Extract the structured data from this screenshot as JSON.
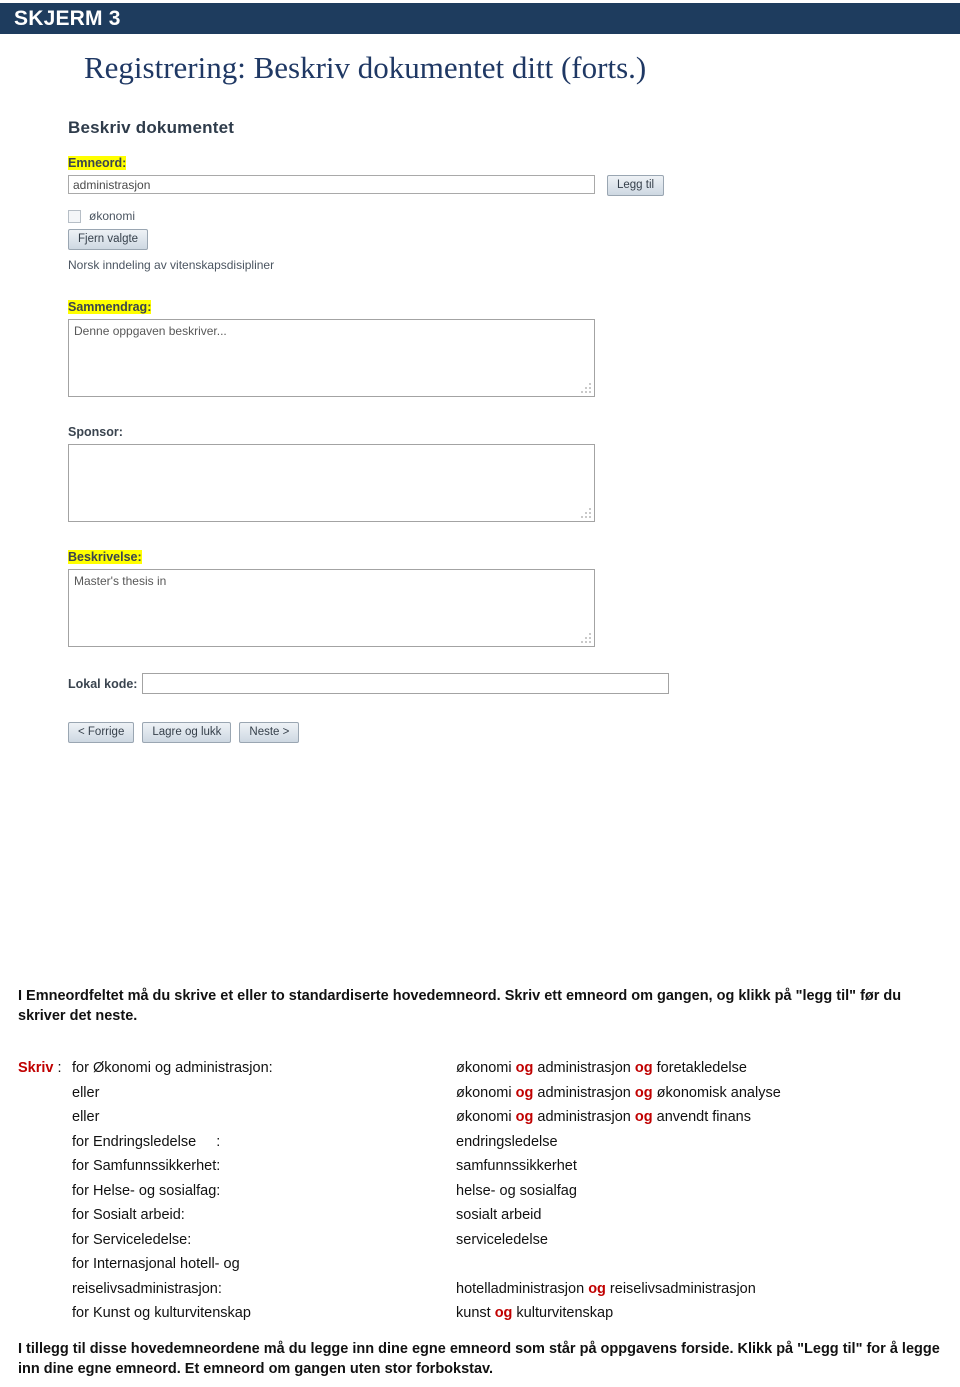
{
  "banner": {
    "label": "SKJERM 3",
    "color": "#1e3c5e"
  },
  "page_title": "Registrering: Beskriv dokumentet ditt (forts.)",
  "screenshot": {
    "heading": "Beskriv dokumentet",
    "emneord": {
      "label": "Emneord:",
      "input_value": "administrasjon",
      "add_button": "Legg til",
      "checkbox_label": "økonomi",
      "remove_button": "Fjern valgte",
      "note": "Norsk inndeling av vitenskapsdisipliner"
    },
    "sammendrag": {
      "label": "Sammendrag:",
      "value": "Denne oppgaven beskriver..."
    },
    "sponsor": {
      "label": "Sponsor:",
      "value": ""
    },
    "beskrivelse": {
      "label": "Beskrivelse:",
      "value": "Master's thesis in"
    },
    "lokal_kode": {
      "label": "Lokal kode:",
      "value": ""
    },
    "nav_buttons": {
      "prev": "< Forrige",
      "save": "Lagre og lukk",
      "next": "Neste >"
    }
  },
  "intro_paragraph": "I Emneordfeltet må du skrive et eller to standardiserte hovedemneord. Skriv ett emneord om gangen, og klikk på \"legg til\" før du skriver det neste.",
  "mapping": {
    "lead_label": "Skriv",
    "lead_colon": " :",
    "highlight_color": "#c00000",
    "rows": [
      {
        "left": "for Økonomi og administrasjon:",
        "right_parts": [
          {
            "t": "økonomi ",
            "red": false
          },
          {
            "t": "og",
            "red": true
          },
          {
            "t": " administrasjon ",
            "red": false
          },
          {
            "t": "og",
            "red": true
          },
          {
            "t": " foretakledelse",
            "red": false
          }
        ]
      },
      {
        "left": "eller",
        "right_parts": [
          {
            "t": "økonomi ",
            "red": false
          },
          {
            "t": "og",
            "red": true
          },
          {
            "t": " administrasjon ",
            "red": false
          },
          {
            "t": "og",
            "red": true
          },
          {
            "t": " økonomisk analyse",
            "red": false
          }
        ]
      },
      {
        "left": "eller",
        "right_parts": [
          {
            "t": "økonomi ",
            "red": false
          },
          {
            "t": "og",
            "red": true
          },
          {
            "t": " administrasjon ",
            "red": false
          },
          {
            "t": "og",
            "red": true
          },
          {
            "t": " anvendt finans",
            "red": false
          }
        ]
      },
      {
        "left": "for Endringsledelse     :",
        "right_parts": [
          {
            "t": "endringsledelse",
            "red": false
          }
        ]
      },
      {
        "left": "for Samfunnssikkerhet:",
        "right_parts": [
          {
            "t": "samfunnssikkerhet",
            "red": false
          }
        ]
      },
      {
        "left": "for Helse- og sosialfag:",
        "right_parts": [
          {
            "t": "helse- og sosialfag",
            "red": false
          }
        ]
      },
      {
        "left": "for Sosialt arbeid:",
        "right_parts": [
          {
            "t": "sosialt arbeid",
            "red": false
          }
        ]
      },
      {
        "left": "for Serviceledelse:",
        "right_parts": [
          {
            "t": "serviceledelse",
            "red": false
          }
        ]
      },
      {
        "left": "for Internasjonal hotell- og",
        "right_parts": [
          {
            "t": "",
            "red": false
          }
        ]
      },
      {
        "left": "reiselivsadministrasjon:",
        "right_parts": [
          {
            "t": "hotelladministrasjon ",
            "red": false
          },
          {
            "t": "og",
            "red": true
          },
          {
            "t": " reiselivsadministrasjon",
            "red": false
          }
        ]
      },
      {
        "left": "for Kunst og kulturvitenskap",
        "right_parts": [
          {
            "t": "kunst ",
            "red": false
          },
          {
            "t": "og",
            "red": true
          },
          {
            "t": " kulturvitenskap",
            "red": false
          }
        ]
      }
    ]
  },
  "outro_paragraph": "I tillegg til disse hovedemneordene må du legge inn dine egne emneord som står på oppgavens forside. Klikk på \"Legg til\" for å legge inn dine egne emneord. Et emneord om gangen uten stor forbokstav."
}
